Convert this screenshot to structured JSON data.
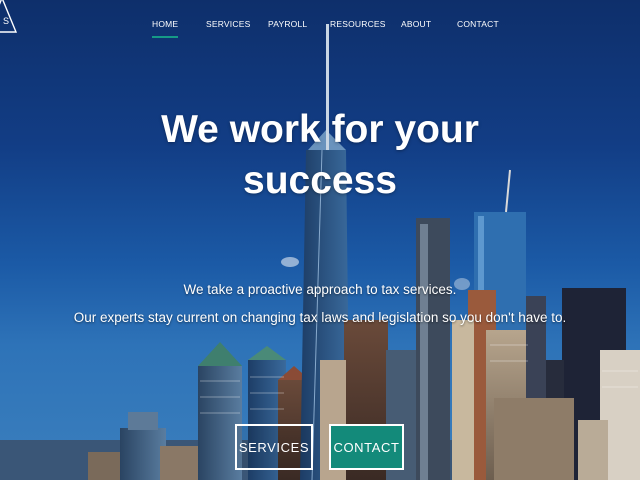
{
  "nav": {
    "items": [
      {
        "label": "HOME",
        "active": true
      },
      {
        "label": "SERVICES",
        "active": false
      },
      {
        "label": "PAYROLL",
        "active": false
      },
      {
        "label": "RESOURCES",
        "active": false
      },
      {
        "label": "ABOUT",
        "active": false
      },
      {
        "label": "CONTACT",
        "active": false
      }
    ]
  },
  "hero": {
    "headline_line1": "We work for your",
    "headline_line2": "success",
    "tagline_line1": "We take a proactive approach to tax services.",
    "tagline_line2": "Our experts stay current on changing tax laws and legislation so you don't have to."
  },
  "buttons": {
    "services_label": "SERVICES",
    "contact_label": "CONTACT"
  },
  "colors": {
    "accent": "#138a7a",
    "sky_top": "#0e2f6b",
    "sky_bottom": "#3b7fbd"
  },
  "icons": {
    "logo": "triangle-logo-icon"
  }
}
